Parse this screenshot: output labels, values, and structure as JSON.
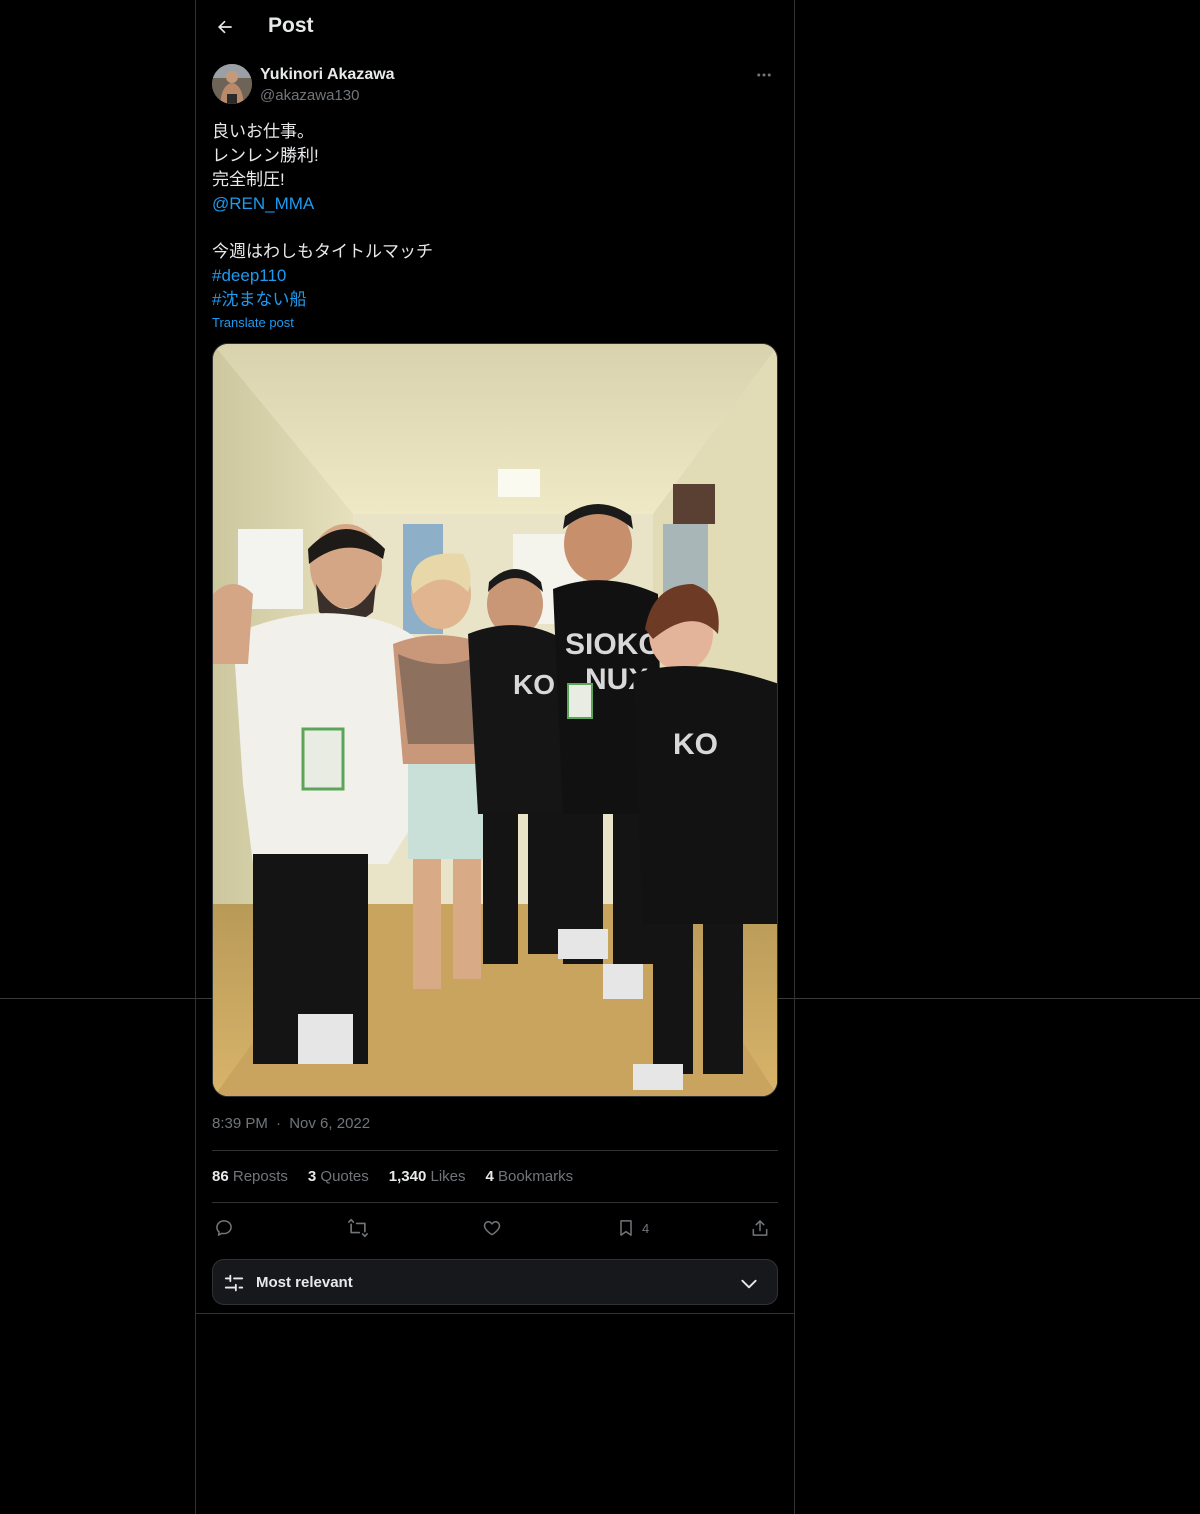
{
  "header": {
    "title": "Post",
    "back_icon": "arrow-left-icon"
  },
  "author": {
    "display_name": "Yukinori Akazawa",
    "handle": "@akazawa130",
    "more_icon": "more-horizontal-icon"
  },
  "tweet": {
    "lines": [
      {
        "text": "良いお仕事。",
        "link": false
      },
      {
        "text": "レンレン勝利!",
        "link": false
      },
      {
        "text": "完全制圧!",
        "link": false
      },
      {
        "text": "@REN_MMA",
        "link": true
      },
      {
        "text": "",
        "link": false
      },
      {
        "text": "今週はわしもタイトルマッチ",
        "link": false
      },
      {
        "text": "#deep110",
        "link": true
      },
      {
        "text": "#沈まない船",
        "link": true
      }
    ],
    "translate_label": "Translate post"
  },
  "meta": {
    "time": "8:39 PM",
    "separator": "·",
    "date": "Nov 6, 2022"
  },
  "stats": {
    "reposts": {
      "count": "86",
      "label": "Reposts"
    },
    "quotes": {
      "count": "3",
      "label": "Quotes"
    },
    "likes": {
      "count": "1,340",
      "label": "Likes"
    },
    "bookmarks": {
      "count": "4",
      "label": "Bookmarks"
    }
  },
  "actions": {
    "reply_icon": "reply-icon",
    "repost_icon": "repost-icon",
    "like_icon": "heart-icon",
    "bookmark_icon": "bookmark-icon",
    "bookmark_count": "4",
    "share_icon": "share-icon"
  },
  "sort": {
    "label": "Most relevant",
    "icon": "sliders-icon",
    "chevron": "chevron-down-icon"
  },
  "colors": {
    "background": "#000000",
    "text": "#e7e9ea",
    "muted": "#71767b",
    "link": "#1d9bf0",
    "border": "#2f3336"
  }
}
